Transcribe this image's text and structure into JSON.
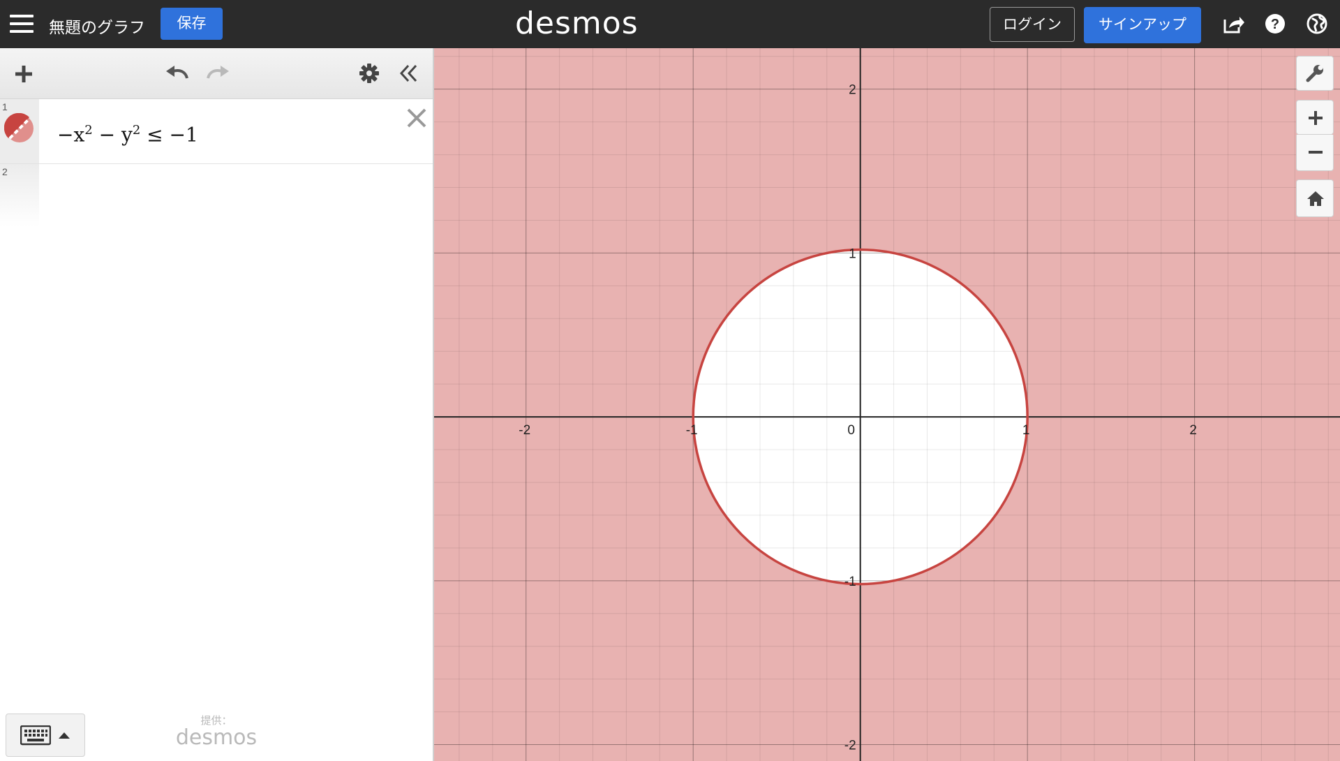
{
  "header": {
    "title": "無題のグラフ",
    "save_label": "保存",
    "logo": "desmos",
    "login_label": "ログイン",
    "signup_label": "サインアップ",
    "icons": [
      "menu-icon",
      "share-icon",
      "help-icon",
      "globe-icon"
    ]
  },
  "expressions": [
    {
      "index": "1",
      "latex_parts": {
        "a": "−x",
        "e1": "2",
        "b": " − y",
        "e2": "2",
        "c": " ≤ −1"
      },
      "color": "#c74440"
    },
    {
      "index": "2"
    }
  ],
  "footer": {
    "powered_by": "提供：",
    "logo": "desmos"
  },
  "graph": {
    "x_ticks": [
      "-2",
      "-1",
      "0",
      "1",
      "2"
    ],
    "y_ticks": [
      "2",
      "1",
      "-1",
      "-2"
    ],
    "fill_color": "#e8b2b1",
    "curve_color": "#c74440",
    "radius": 1
  },
  "chart_data": {
    "type": "inequality-plot",
    "expression": "-x^2 - y^2 <= -1",
    "shaded_region": "outside unit circle",
    "boundary": "circle x^2 + y^2 = 1",
    "xlim": [
      -2.55,
      2.87
    ],
    "ylim": [
      -2.1,
      2.25
    ],
    "grid": true
  }
}
